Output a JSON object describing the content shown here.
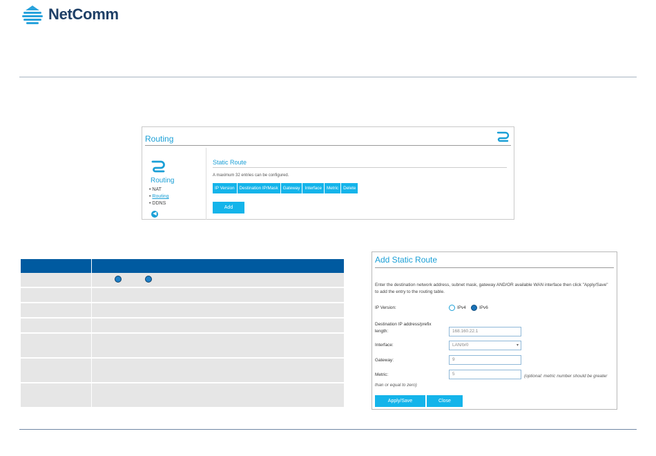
{
  "brand": {
    "name": "NetComm",
    "logo_color": "#1e3f66"
  },
  "routing_panel": {
    "title": "Routing",
    "sidebar": {
      "title": "Routing",
      "items": [
        {
          "label": "NAT"
        },
        {
          "label": "Routing"
        },
        {
          "label": "DDNS"
        }
      ]
    },
    "section_title": "Static Route",
    "note": "A maximum 32 entries can be configured.",
    "columns": [
      "IP Version",
      "Destination IP/Mask",
      "Gateway",
      "Interface",
      "Metric",
      "Delete"
    ],
    "add_label": "Add"
  },
  "dialog": {
    "title": "Add Static Route",
    "instructions": "Enter the destination network address, subnet mask, gateway AND/OR available WAN interface then click \"Apply/Save\" to add the entry to the routing table.",
    "ip_version_label": "IP Version:",
    "ipv4_label": "IPv4",
    "ipv6_label": "IPv6",
    "dest_label_1": "Destination IP address/prefix",
    "dest_label_2": "length:",
    "dest_value": "168.160.22.1",
    "interface_label": "Interface:",
    "interface_value": "LAN/br0",
    "gateway_label": "Gateway:",
    "gateway_value": "9",
    "metric_label": "Metric:",
    "metric_value": "5",
    "metric_note": "(optional: metric number should be greater than or equal to zero)",
    "apply_label": "Apply/Save",
    "close_label": "Close"
  },
  "colors": {
    "accent": "#14b4ea",
    "table_header": "#005aa0",
    "row_bg": "#e6e6e6"
  }
}
